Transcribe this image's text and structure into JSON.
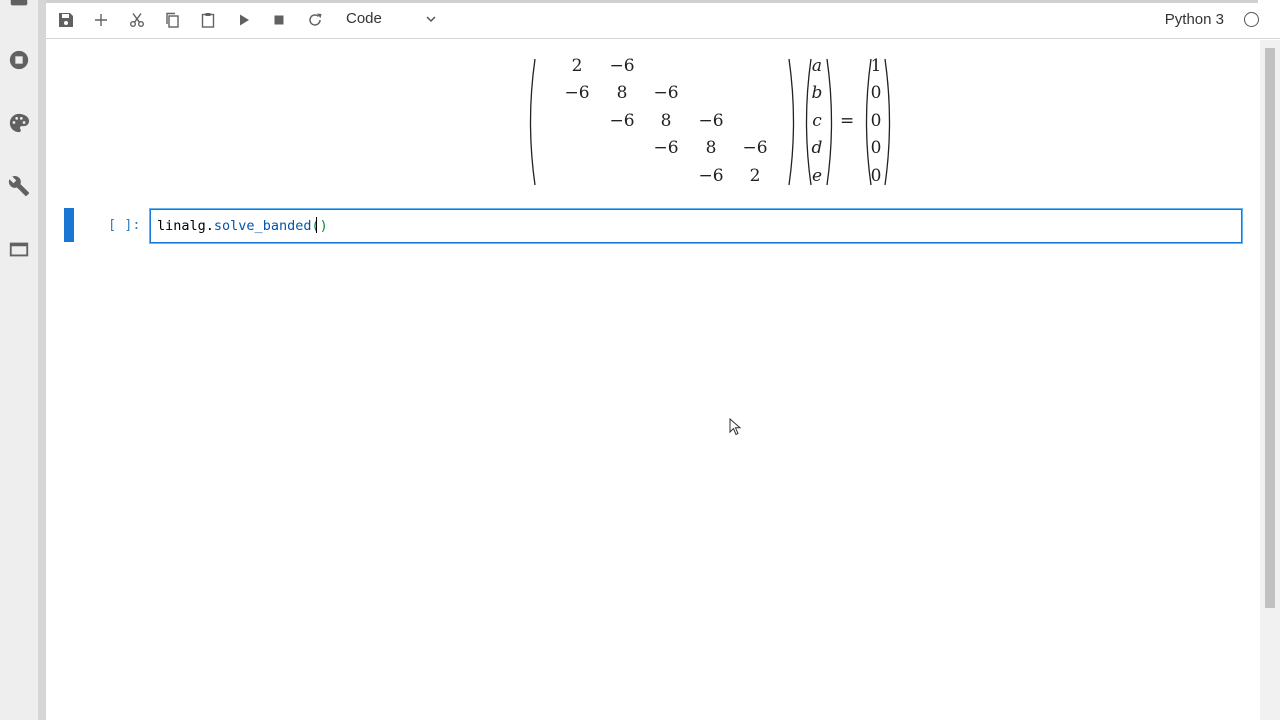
{
  "toolbar": {
    "cell_type": "Code",
    "kernel_name": "Python 3"
  },
  "math": {
    "matrix": [
      [
        "2",
        "−6",
        "",
        "",
        ""
      ],
      [
        "−6",
        "8",
        "−6",
        "",
        ""
      ],
      [
        "",
        "−6",
        "8",
        "−6",
        ""
      ],
      [
        "",
        "",
        "−6",
        "8",
        "−6"
      ],
      [
        "",
        "",
        "",
        "−6",
        "2"
      ]
    ],
    "unknowns": [
      "a",
      "b",
      "c",
      "d",
      "e"
    ],
    "equals": "=",
    "rhs": [
      "1",
      "0",
      "0",
      "0",
      "0"
    ]
  },
  "cell": {
    "prompt": "[ ]:",
    "code_var": "linalg",
    "code_dot": ".",
    "code_attr": "solve_banded",
    "code_open": "(",
    "code_close": ")"
  },
  "colors": {
    "accent": "#1976d2",
    "prompt": "#307fc1"
  },
  "icons": {
    "leftbar": [
      "running-icon",
      "stop-circle-icon",
      "palette-icon",
      "wrench-icon",
      "tabs-icon"
    ],
    "toolbar": [
      "save-icon",
      "add-icon",
      "cut-icon",
      "copy-icon",
      "paste-icon",
      "run-icon",
      "stop-icon",
      "restart-icon"
    ]
  }
}
